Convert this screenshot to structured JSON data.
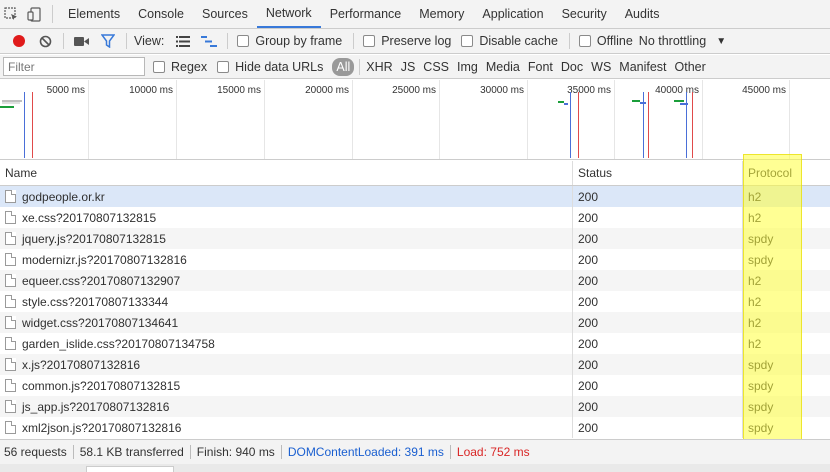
{
  "tabs": [
    "Elements",
    "Console",
    "Sources",
    "Network",
    "Performance",
    "Memory",
    "Application",
    "Security",
    "Audits"
  ],
  "active_tab": "Network",
  "toolbar": {
    "view_label": "View:",
    "group_by_frame": "Group by frame",
    "preserve_log": "Preserve log",
    "disable_cache": "Disable cache",
    "offline": "Offline",
    "throttling": "No throttling"
  },
  "filter": {
    "placeholder": "Filter",
    "regex": "Regex",
    "hide_data_urls": "Hide data URLs",
    "types": [
      "All",
      "XHR",
      "JS",
      "CSS",
      "Img",
      "Media",
      "Font",
      "Doc",
      "WS",
      "Manifest",
      "Other"
    ]
  },
  "overview": {
    "ticks": [
      "5000 ms",
      "10000 ms",
      "15000 ms",
      "20000 ms",
      "25000 ms",
      "30000 ms",
      "35000 ms",
      "40000 ms",
      "45000 ms"
    ]
  },
  "table": {
    "columns": [
      "Name",
      "Status",
      "Protocol"
    ],
    "rows": [
      {
        "name": "godpeople.or.kr",
        "status": "200",
        "protocol": "h2"
      },
      {
        "name": "xe.css?20170807132815",
        "status": "200",
        "protocol": "h2"
      },
      {
        "name": "jquery.js?20170807132815",
        "status": "200",
        "protocol": "spdy"
      },
      {
        "name": "modernizr.js?20170807132816",
        "status": "200",
        "protocol": "spdy"
      },
      {
        "name": "equeer.css?20170807132907",
        "status": "200",
        "protocol": "h2"
      },
      {
        "name": "style.css?20170807133344",
        "status": "200",
        "protocol": "h2"
      },
      {
        "name": "widget.css?20170807134641",
        "status": "200",
        "protocol": "h2"
      },
      {
        "name": "garden_islide.css?20170807134758",
        "status": "200",
        "protocol": "h2"
      },
      {
        "name": "x.js?20170807132816",
        "status": "200",
        "protocol": "spdy"
      },
      {
        "name": "common.js?20170807132815",
        "status": "200",
        "protocol": "spdy"
      },
      {
        "name": "js_app.js?20170807132816",
        "status": "200",
        "protocol": "spdy"
      },
      {
        "name": "xml2json.js?20170807132816",
        "status": "200",
        "protocol": "spdy"
      }
    ]
  },
  "status_bar": {
    "requests": "56 requests",
    "transferred": "58.1 KB transferred",
    "finish": "Finish: 940 ms",
    "dom_content_loaded": "DOMContentLoaded: 391 ms",
    "load": "Load: 752 ms"
  },
  "colors": {
    "record": "#e01b1b",
    "active_tab_underline": "#3879d9",
    "dom_content_loaded": "#1a5fd0",
    "load": "#d92626",
    "highlight": "#ffff3c"
  }
}
